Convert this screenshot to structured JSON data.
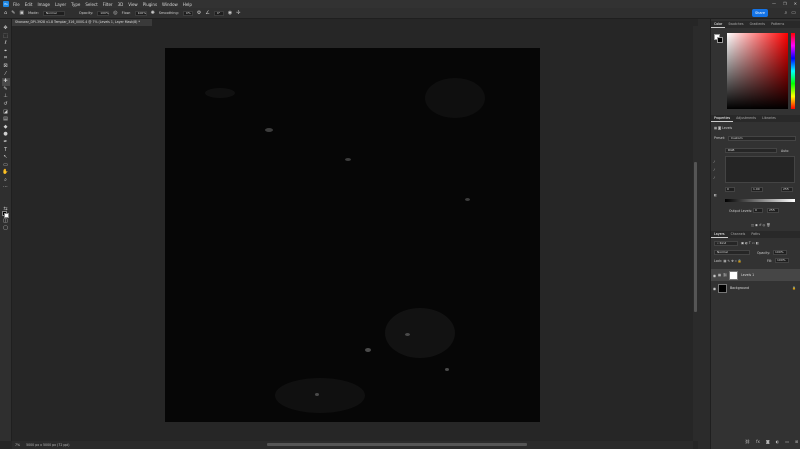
{
  "menubar": {
    "logo": "Ps",
    "items": [
      "File",
      "Edit",
      "Image",
      "Layer",
      "Type",
      "Select",
      "Filter",
      "3D",
      "View",
      "Plugins",
      "Window",
      "Help"
    ],
    "window_controls": [
      "—",
      "❐",
      "✕"
    ]
  },
  "options": {
    "mode_label": "Mode:",
    "mode_value": "Normal",
    "opacity_label": "Opacity:",
    "opacity_value": "100%",
    "flow_label": "Flow:",
    "flow_value": "100%",
    "smoothing_label": "Smoothing:",
    "smoothing_value": "0%",
    "angle_value": "0°",
    "share_label": "Share"
  },
  "document": {
    "tab_title": "Shanwar_DPI-3928 v1.8 Tempiar_316_000S-4 @ 7% (Levels 1, Layer Mask/8) *"
  },
  "status": {
    "zoom": "7%",
    "dimensions": "5000 px x 5000 px (72 ppi)"
  },
  "color_panel": {
    "tabs": [
      "Color",
      "Swatches",
      "Gradients",
      "Patterns"
    ]
  },
  "properties_panel": {
    "tabs": [
      "Properties",
      "Adjustments",
      "Libraries"
    ],
    "section": "Levels",
    "preset_label": "Preset:",
    "preset_value": "Custom",
    "channel_value": "RGB",
    "auto_label": "Auto",
    "input_black": "0",
    "input_mid": "1.00",
    "input_white": "255",
    "output_label": "Output Levels:",
    "output_black": "0",
    "output_white": "255"
  },
  "layers_panel": {
    "tabs": [
      "Layers",
      "Channels",
      "Paths"
    ],
    "kind_label": "Kind",
    "blend_mode": "Normal",
    "opacity_label": "Opacity:",
    "opacity_value": "100%",
    "lock_label": "Lock:",
    "fill_label": "Fill:",
    "fill_value": "100%",
    "layers": [
      {
        "name": "Levels 1"
      },
      {
        "name": "Background"
      }
    ]
  }
}
